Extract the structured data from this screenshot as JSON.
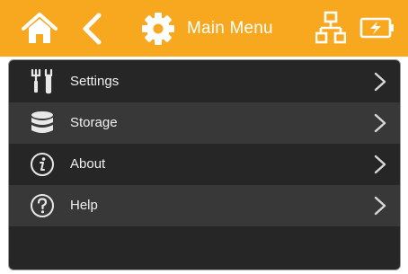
{
  "header": {
    "title": "Main Menu",
    "background": "#f7a81f",
    "icons": [
      "home-icon",
      "back-arrow-icon",
      "gear-icon",
      "network-icon",
      "battery-charging-icon"
    ]
  },
  "menu": {
    "items": [
      {
        "label": "Settings",
        "icon": "tools-icon"
      },
      {
        "label": "Storage",
        "icon": "database-icon"
      },
      {
        "label": "About",
        "icon": "info-icon"
      },
      {
        "label": "Help",
        "icon": "question-icon"
      }
    ]
  }
}
